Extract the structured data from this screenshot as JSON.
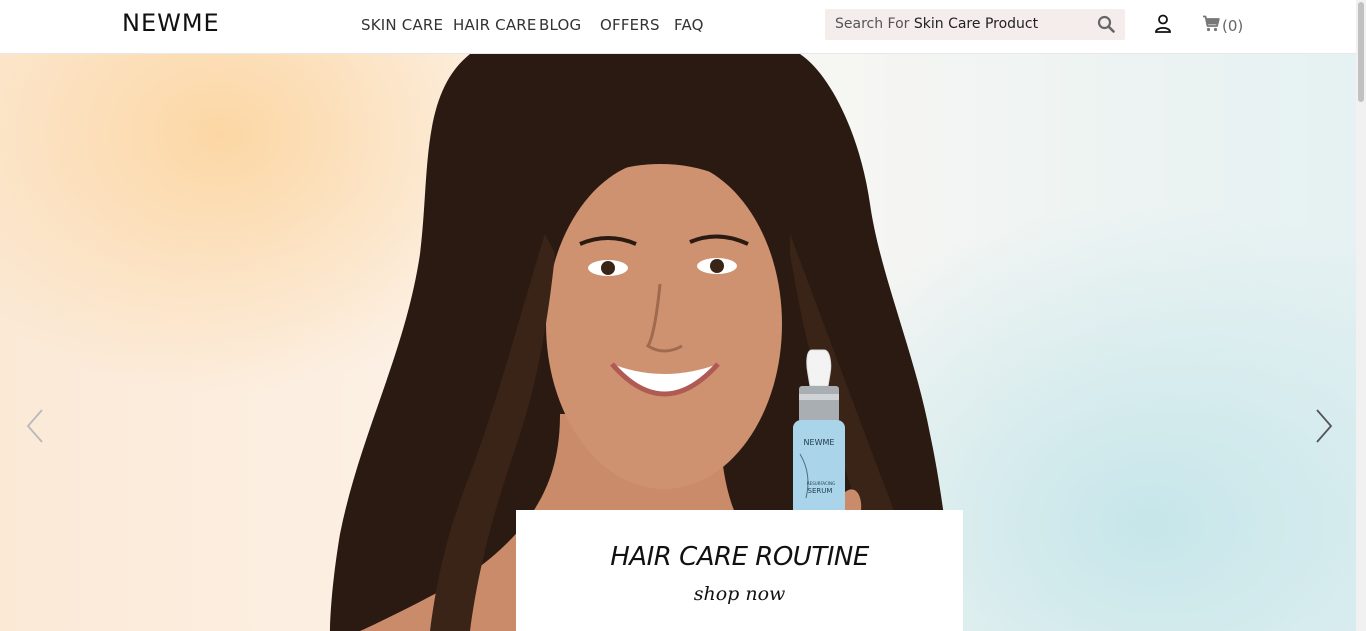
{
  "header": {
    "logo": "NEWME",
    "nav": [
      "SKIN CARE",
      "HAIR CARE",
      "BLOG",
      "OFFERS",
      "FAQ"
    ],
    "search": {
      "placeholder_prefix": "Search For ",
      "placeholder_term": "Skin Care Product",
      "icon": "search-icon"
    },
    "user_icon": "user-icon",
    "cart": {
      "icon": "cart-icon",
      "count_label": "(0)"
    }
  },
  "hero": {
    "product_brand": "NEWME",
    "product_subtitle": "RESURFACING",
    "product_name": "SERUM",
    "caption_title": "HAIR CARE ROUTINE",
    "caption_cta": "shop now",
    "prev_icon": "chevron-left-icon",
    "next_icon": "chevron-right-icon"
  },
  "colors": {
    "search_bg": "#f5ecec",
    "peach": "#fcd7a4",
    "aqua": "#c6e6ea",
    "hair": "#2a1a12",
    "skin": "#c98b6a",
    "bottle": "#a9d4ea"
  }
}
